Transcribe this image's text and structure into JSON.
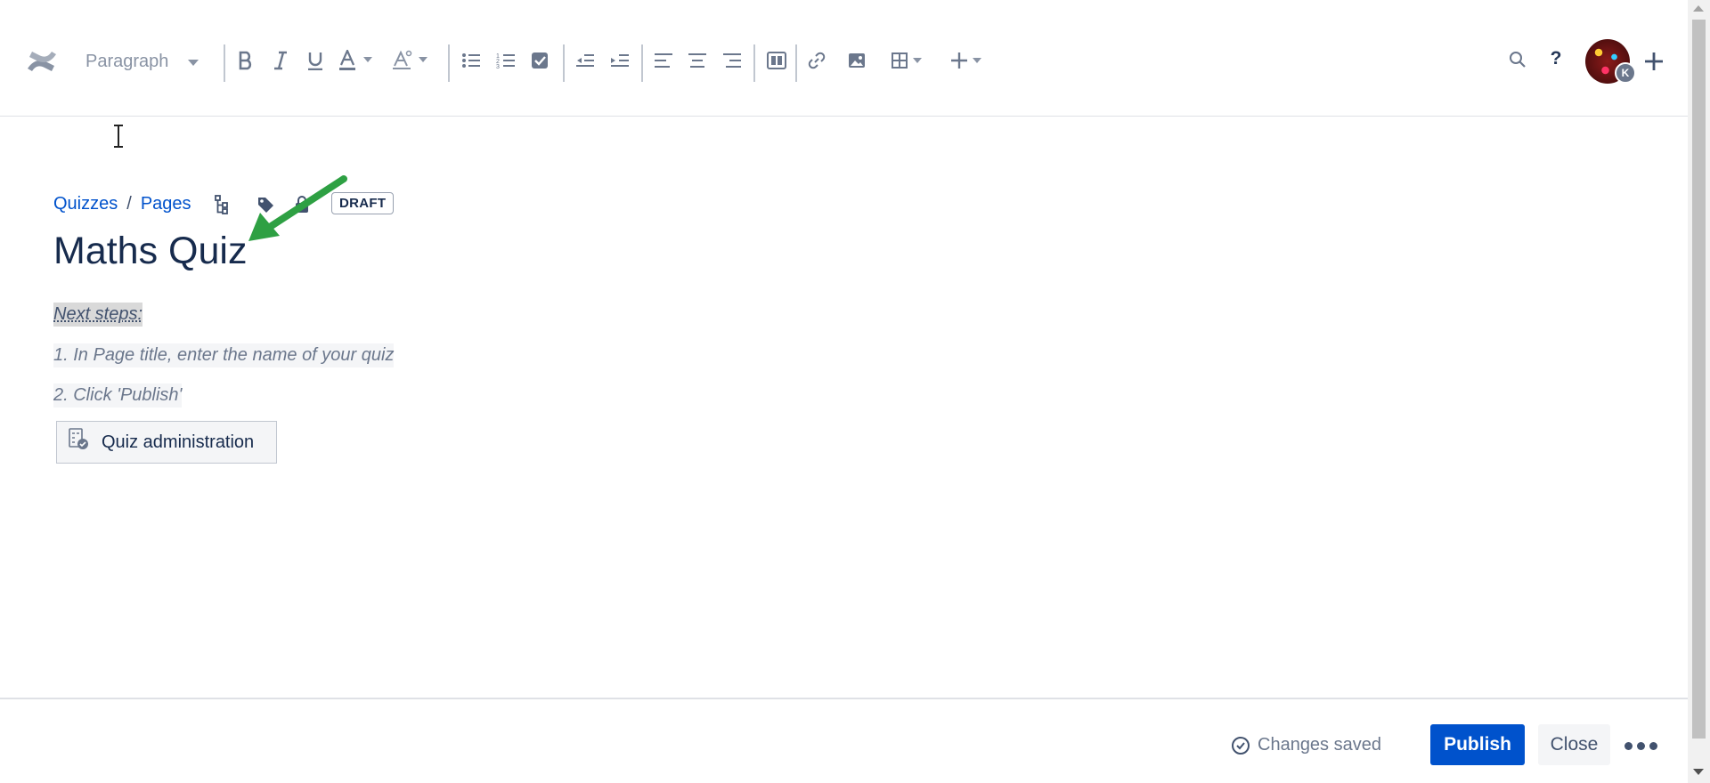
{
  "toolbar": {
    "paragraph_label": "Paragraph",
    "icons": [
      "confluence-logo",
      "bold",
      "italic",
      "underline",
      "text-color",
      "text-style",
      "bullet-list",
      "numbered-list",
      "task-list",
      "outdent",
      "indent",
      "align-left",
      "align-center",
      "align-right",
      "page-layout",
      "link",
      "image",
      "table",
      "insert-more",
      "search",
      "help",
      "create"
    ],
    "help_label": "?",
    "avatar_badge": "K"
  },
  "breadcrumb": {
    "items": [
      "Quizzes",
      "Pages"
    ],
    "separator": "/"
  },
  "draft_badge": "DRAFT",
  "page": {
    "title": "Maths Quiz",
    "instructions": [
      "Next steps:",
      "1. In Page title, enter the name of your quiz",
      "2. Click 'Publish'"
    ],
    "macro_button": "Quiz administration"
  },
  "footer": {
    "status": "Changes saved",
    "publish_label": "Publish",
    "close_label": "Close"
  },
  "colors": {
    "accent": "#0052cc",
    "arrow": "#2ea043"
  }
}
